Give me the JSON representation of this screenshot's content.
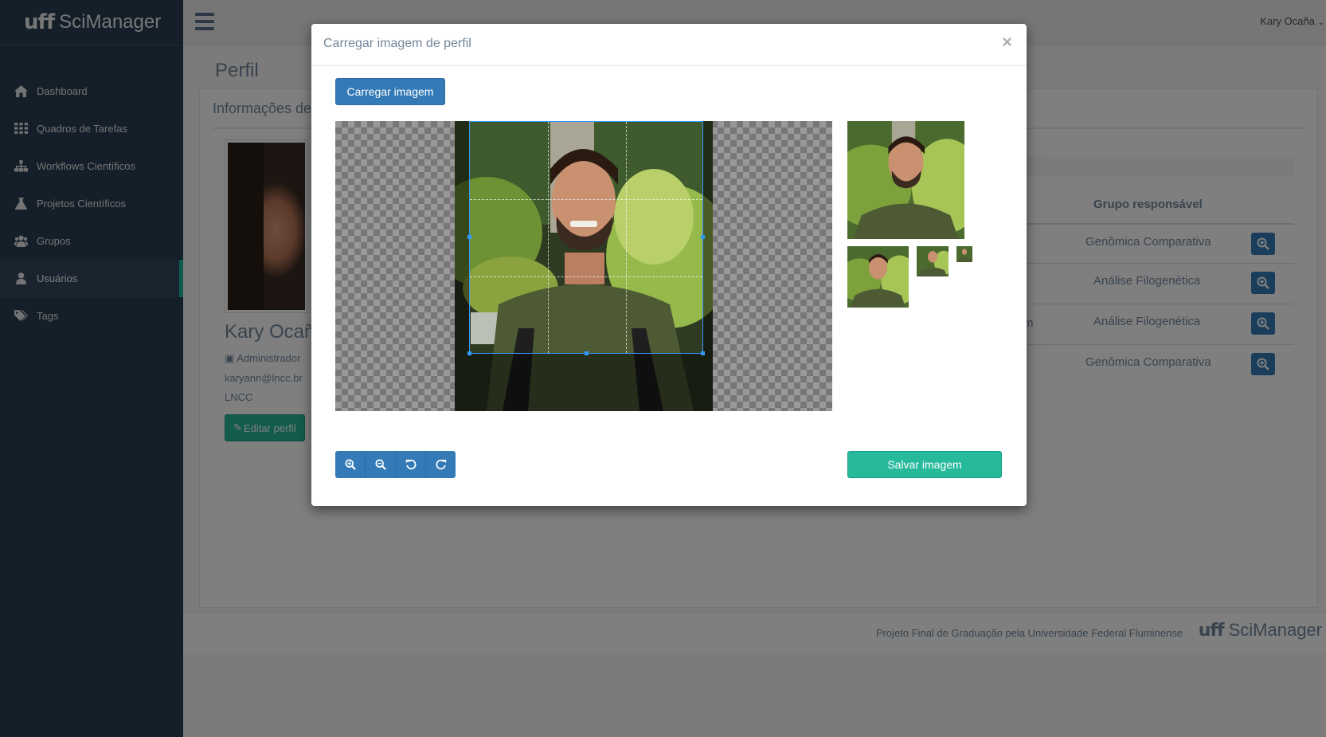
{
  "app": {
    "brand_logo": "uff",
    "brand_name": "SciManager"
  },
  "sidebar": {
    "items": [
      {
        "label": "Dashboard",
        "icon": "home-icon"
      },
      {
        "label": "Quadros de Tarefas",
        "icon": "grid-icon"
      },
      {
        "label": "Workflows Científicos",
        "icon": "sitemap-icon"
      },
      {
        "label": "Projetos Científicos",
        "icon": "flask-icon"
      },
      {
        "label": "Grupos",
        "icon": "users-icon"
      },
      {
        "label": "Usuários",
        "icon": "user-icon",
        "active": true
      },
      {
        "label": "Tags",
        "icon": "tags-icon"
      }
    ]
  },
  "topnav": {
    "user": "Kary Ocaña"
  },
  "page": {
    "title": "Perfil",
    "panel_title": "Informações de",
    "profile": {
      "name": "Kary Ocañ",
      "role": "Administrador",
      "email": "karyann@lncc.br",
      "institution": "LNCC",
      "edit_button": "Editar perfil"
    },
    "table": {
      "header": "Grupo responsável",
      "partial_text": "m",
      "rows": [
        {
          "group": "Genômica Comparativa"
        },
        {
          "group": "Análise Filogenética"
        },
        {
          "group": "Análise Filogenética"
        },
        {
          "group": "Genômica Comparativa"
        }
      ]
    }
  },
  "footer": {
    "text": "Projeto Final de Graduação pela Universidade Federal Fluminense",
    "brand_logo": "uff",
    "brand_name": "SciManager"
  },
  "modal": {
    "title": "Carregar imagem de perfil",
    "close": "×",
    "upload_button": "Carregar imagem",
    "save_button": "Salvar imagem",
    "tools": [
      "zoom-in-icon",
      "zoom-out-icon",
      "rotate-left-icon",
      "rotate-right-icon"
    ]
  },
  "colors": {
    "sidebar_bg": "#2a3f54",
    "accent_green": "#26b99a",
    "primary_blue": "#337ab7"
  }
}
